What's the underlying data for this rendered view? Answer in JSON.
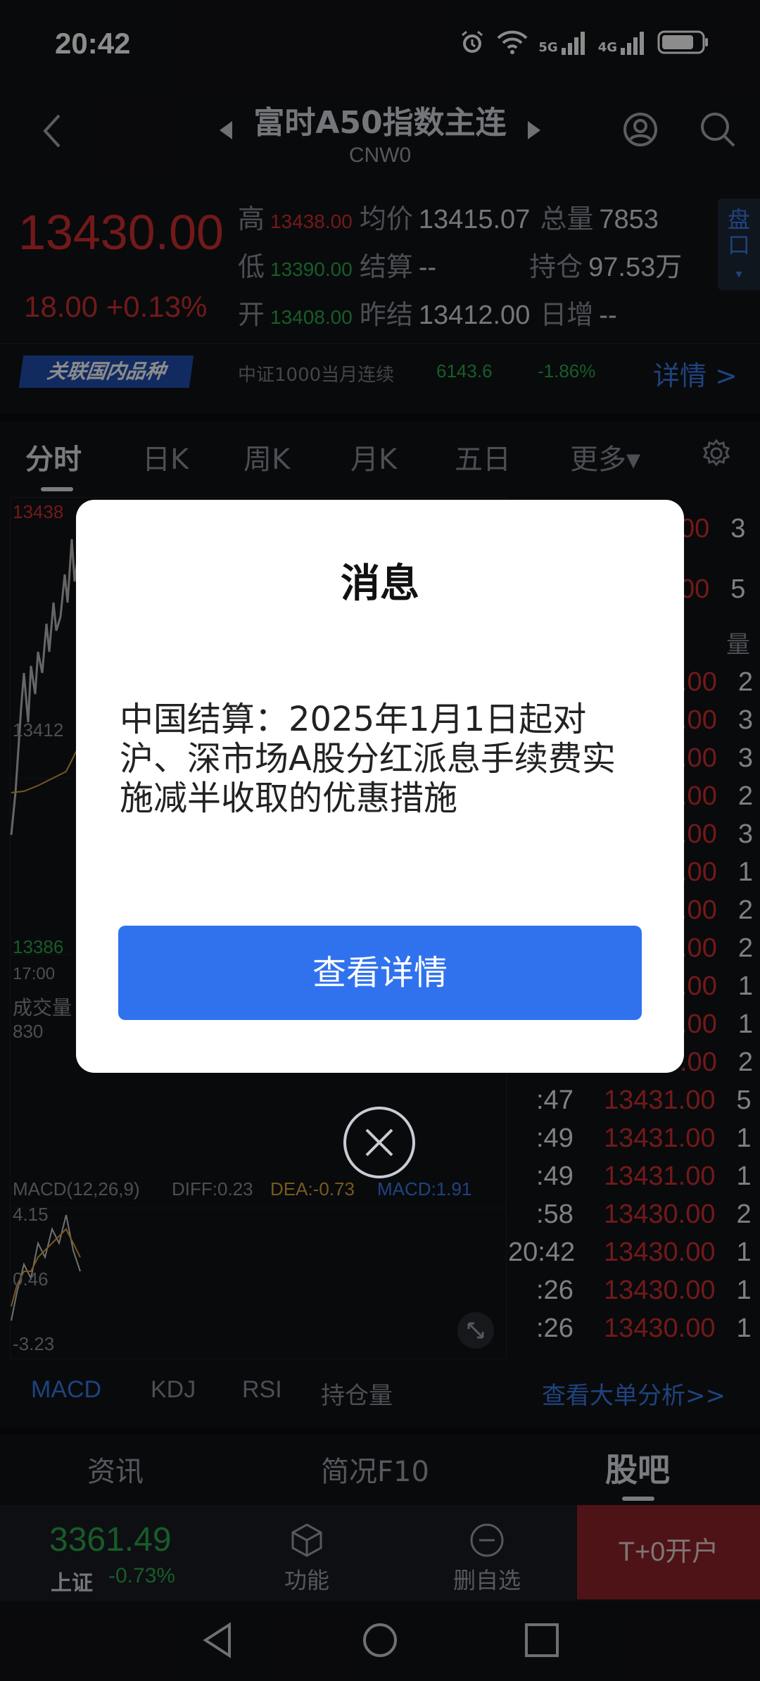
{
  "status": {
    "time": "20:42",
    "net1": "5G",
    "net2": "4G"
  },
  "header": {
    "title": "富时A50指数主连",
    "code": "CNW0"
  },
  "quote": {
    "price": "13430.00",
    "change": "18.00",
    "change_pct": "+0.13%",
    "high_label": "高",
    "high": "13438.00",
    "low_label": "低",
    "low": "13390.00",
    "open_label": "开",
    "open": "13408.00",
    "avg_label": "均价",
    "avg": "13415.07",
    "settle_label": "结算",
    "settle": "--",
    "prev_settle_label": "昨结",
    "prev_settle": "13412.00",
    "vol_label": "总量",
    "vol": "7853",
    "oi_label": "持仓",
    "oi": "97.53万",
    "daily_inc_label": "日增",
    "daily_inc": "--",
    "pankou": "盘口"
  },
  "linked": {
    "badge": "关联国内品种",
    "name": "中证1000当月连续",
    "value": "6143.6",
    "pct": "-1.86%",
    "detail": "详情 >"
  },
  "tabs": [
    "分时",
    "日K",
    "周K",
    "月K",
    "五日",
    "更多▾"
  ],
  "chart": {
    "top_price": "13438",
    "mid_price": "13412",
    "low_price": "13386",
    "time_label": "17:00",
    "vol_title": "成交量",
    "vol_value": "830",
    "macd_title": "MACD(12,26,9)",
    "diff": "DIFF:0.23",
    "dea": "DEA:-0.73",
    "macd": "MACD:1.91",
    "macd_top": "4.15",
    "macd_mid": "0.46",
    "macd_low": "-3.23"
  },
  "right_list": {
    "top": [
      {
        "price": "00",
        "qty": "3"
      },
      {
        "price": "00",
        "qty": "5"
      }
    ],
    "header_qty": "量",
    "mid": [
      {
        "price": ".00",
        "qty": "2"
      },
      {
        "price": ".00",
        "qty": "3"
      },
      {
        "price": ".00",
        "qty": "3"
      },
      {
        "price": ".00",
        "qty": "2"
      },
      {
        "price": ".00",
        "qty": "3"
      },
      {
        "price": ".00",
        "qty": "1"
      },
      {
        "price": ".00",
        "qty": "2"
      },
      {
        "price": ".00",
        "qty": "2"
      },
      {
        "price": ".00",
        "qty": "1"
      },
      {
        "price": ".00",
        "qty": "1"
      },
      {
        "price": ".00",
        "qty": "2"
      }
    ],
    "rows": [
      {
        "time": ":47",
        "price": "13431.00",
        "qty": "5"
      },
      {
        "time": ":49",
        "price": "13431.00",
        "qty": "1"
      },
      {
        "time": ":49",
        "price": "13431.00",
        "qty": "1"
      },
      {
        "time": ":58",
        "price": "13430.00",
        "qty": "2"
      },
      {
        "time": "20:42",
        "price": "13430.00",
        "qty": "1"
      },
      {
        "time": ":26",
        "price": "13430.00",
        "qty": "1"
      },
      {
        "time": ":26",
        "price": "13430.00",
        "qty": "1"
      }
    ]
  },
  "indicators": [
    "MACD",
    "KDJ",
    "RSI",
    "持仓量"
  ],
  "big_order": "查看大单分析>>",
  "lower_tabs": [
    "资讯",
    "简况F10",
    "股吧"
  ],
  "bottom": {
    "index_value": "3361.49",
    "index_name": "上证",
    "index_pct": "-0.73%",
    "func": "功能",
    "remove": "删自选",
    "open_account": "T+0开户"
  },
  "modal": {
    "title": "消息",
    "message": "中国结算：2025年1月1日起对沪、深市场A股分红派息手续费实施减半收取的优惠措施",
    "button": "查看详情"
  }
}
